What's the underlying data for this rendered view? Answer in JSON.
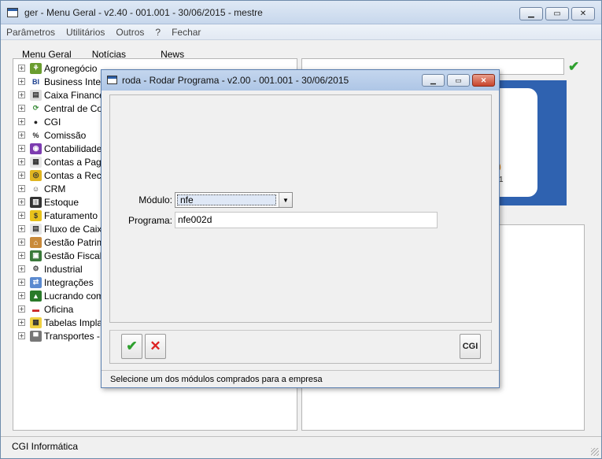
{
  "main_window": {
    "title": "ger - Menu Geral - v2.40 - 001.001 - 30/06/2015 - mestre",
    "controls": [
      "minimize",
      "maximize",
      "close"
    ]
  },
  "menubar": [
    "Parâmetros",
    "Utilitários",
    "Outros",
    "?",
    "Fechar"
  ],
  "tabs": [
    "Menu Geral",
    "Notícias",
    "News"
  ],
  "tree": [
    {
      "label": "Agronegócio",
      "icon": "agro-icon"
    },
    {
      "label": "Business Intellig",
      "icon": "bi-icon"
    },
    {
      "label": "Caixa Financeiro",
      "icon": "cash-icon"
    },
    {
      "label": "Central de Comp",
      "icon": "purchase-icon"
    },
    {
      "label": "CGI",
      "icon": "cgi-icon"
    },
    {
      "label": "Comissão",
      "icon": "percent-icon"
    },
    {
      "label": "Contabilidade",
      "icon": "accounting-icon"
    },
    {
      "label": "Contas a Pagar",
      "icon": "payable-icon"
    },
    {
      "label": "Contas a Receb",
      "icon": "receivable-icon"
    },
    {
      "label": "CRM",
      "icon": "crm-icon"
    },
    {
      "label": "Estoque",
      "icon": "stock-icon"
    },
    {
      "label": "Faturamento",
      "icon": "billing-icon"
    },
    {
      "label": "Fluxo de Caixa",
      "icon": "cashflow-icon"
    },
    {
      "label": "Gestão Patrimôr",
      "icon": "asset-icon"
    },
    {
      "label": "Gestão Fiscal",
      "icon": "fiscal-icon"
    },
    {
      "label": "Industrial",
      "icon": "gear-icon"
    },
    {
      "label": "Integrações",
      "icon": "integration-icon"
    },
    {
      "label": "Lucrando com V",
      "icon": "profit-icon"
    },
    {
      "label": "Oficina",
      "icon": "car-icon"
    },
    {
      "label": "Tabelas Implant",
      "icon": "table-icon"
    },
    {
      "label": "Transportes - Tl",
      "icon": "truck-icon"
    }
  ],
  "status_main": "CGI Informática",
  "logo": {
    "fragment_top": "0",
    "fragment_bottom": "1"
  },
  "dialog": {
    "title": "roda - Rodar Programa - v2.00 - 001.001 - 30/06/2015",
    "modulo_label": "Módulo:",
    "modulo_value": "nfe",
    "programa_label": "Programa:",
    "programa_value": "nfe002d",
    "status": "Selecione um dos módulos comprados para a empresa",
    "cgi_button": "CGI"
  },
  "colors": {
    "accent_check": "#2ea02e",
    "cancel_x": "#dd2222",
    "logo_blue": "#2f62b0",
    "logo_orange": "#e78a1a"
  }
}
